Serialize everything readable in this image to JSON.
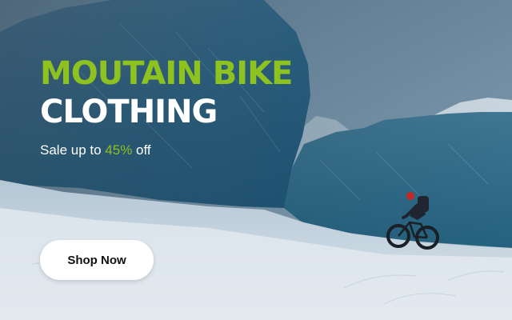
{
  "hero": {
    "title_line1": "MOUTAIN BIKE",
    "title_line2": "CLOTHING",
    "subtitle_prefix": "Sale up to ",
    "subtitle_percent": "45%",
    "subtitle_suffix": " off",
    "button_label": "Shop Now"
  },
  "colors": {
    "accent": "#8dc21f",
    "text_light": "#ffffff",
    "button_bg": "#ffffff",
    "button_text": "#111111"
  }
}
